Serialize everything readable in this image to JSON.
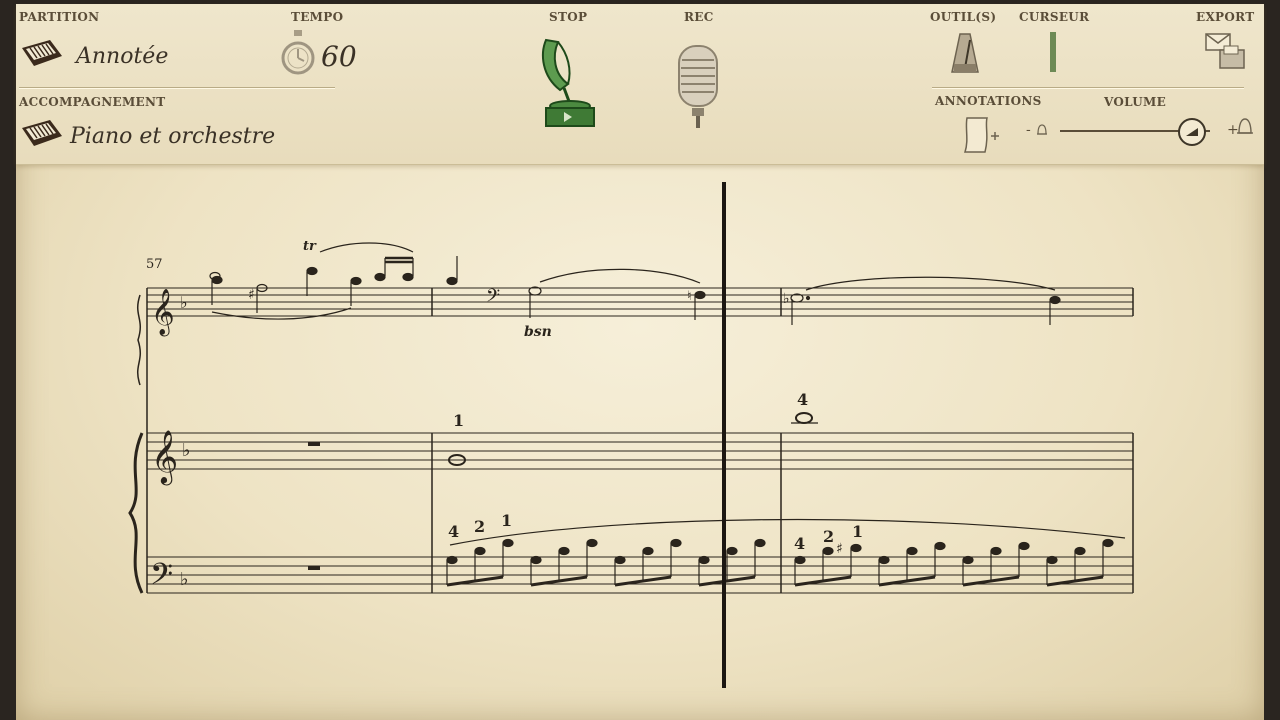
{
  "toolbar": {
    "partition": {
      "label": "PARTITION",
      "value": "Annotée"
    },
    "accompagnement": {
      "label": "ACCOMPAGNEMENT",
      "value": "Piano et orchestre"
    },
    "tempo": {
      "label": "TEMPO",
      "value": "60"
    },
    "stop": {
      "label": "STOP"
    },
    "rec": {
      "label": "REC"
    },
    "outils": {
      "label": "OUTIL(S)"
    },
    "curseur": {
      "label": "CURSEUR"
    },
    "export": {
      "label": "EXPORT"
    },
    "annotations": {
      "label": "ANNOTATIONS"
    },
    "volume": {
      "label": "VOLUME",
      "minus": "-",
      "plus": "+",
      "level": 0.88
    }
  },
  "score": {
    "measure_number": "57",
    "trill": "tr",
    "instrument": "bsn",
    "fingerings": [
      "1",
      "4",
      "4",
      "2",
      "1",
      "4",
      "2",
      "1"
    ]
  },
  "colors": {
    "stop_green": "#2f6b2a",
    "paper": "#f3ead2",
    "ink": "#2a241c"
  }
}
